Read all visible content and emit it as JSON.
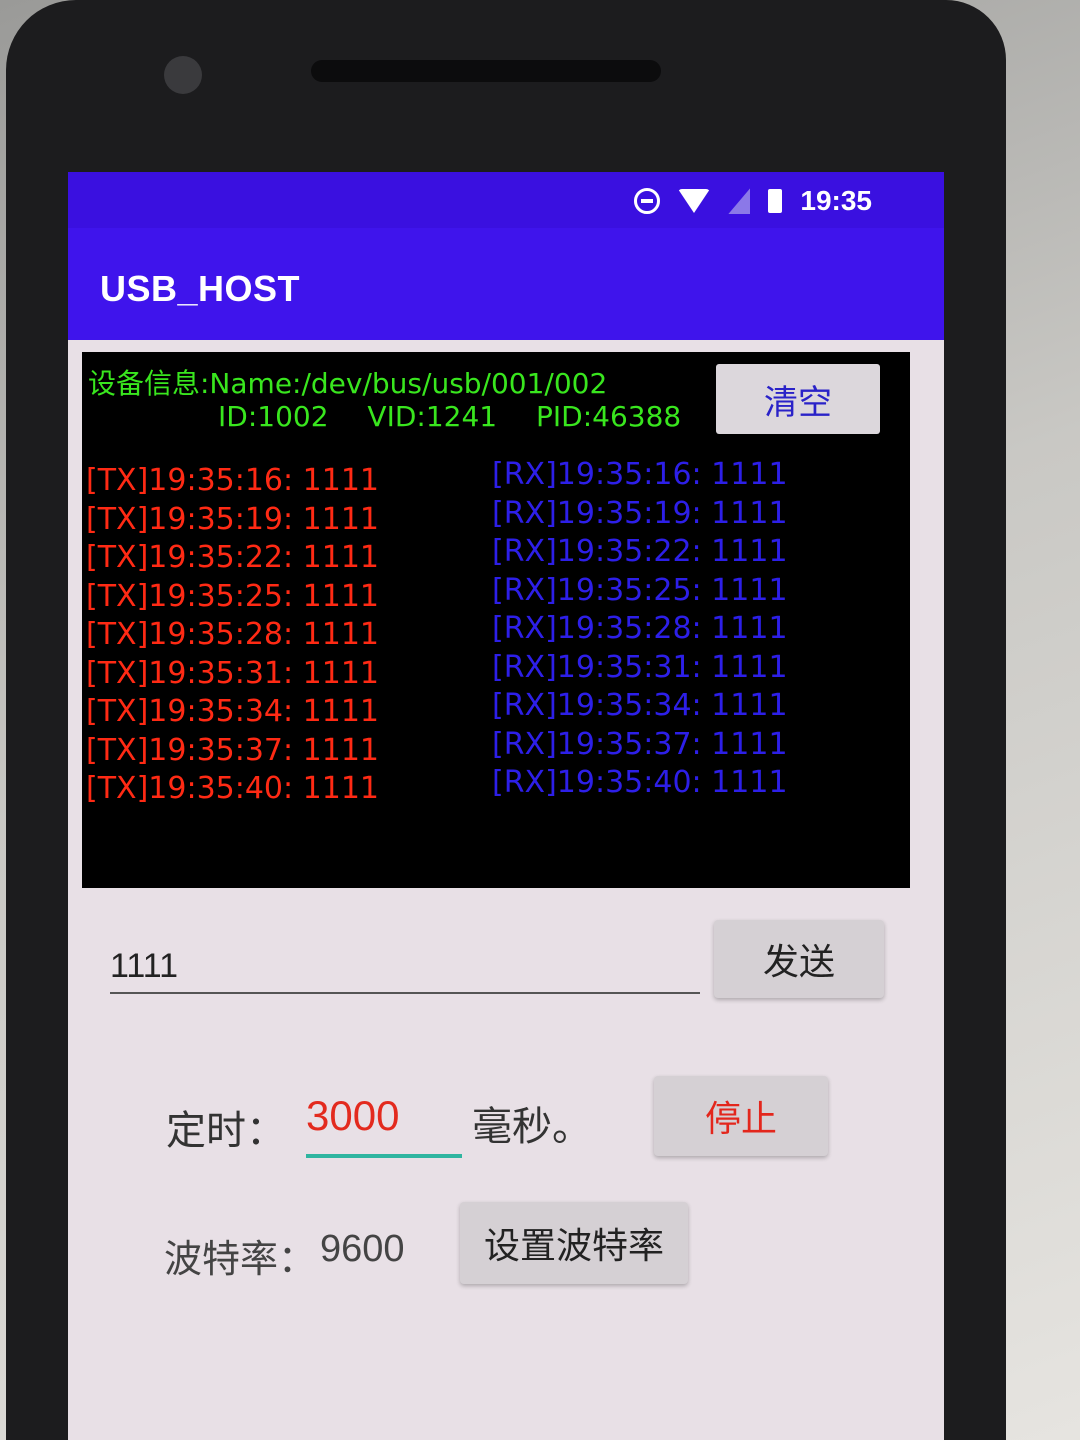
{
  "status_bar": {
    "time": "19:35",
    "icons": [
      "do-not-disturb-icon",
      "wifi-no-internet-icon",
      "no-sim-icon",
      "battery-icon"
    ]
  },
  "app_bar": {
    "title": "USB_HOST"
  },
  "device_info": {
    "line1": "设备信息:Name:/dev/bus/usb/001/002",
    "id": "ID:1002",
    "vid": "VID:1241",
    "pid": "PID:46388"
  },
  "clear_button": "清空",
  "tx_log": [
    "[TX]19:35:16: 1111",
    "[TX]19:35:19: 1111",
    "[TX]19:35:22: 1111",
    "[TX]19:35:25: 1111",
    "[TX]19:35:28: 1111",
    "[TX]19:35:31: 1111",
    "[TX]19:35:34: 1111",
    "[TX]19:35:37: 1111",
    "[TX]19:35:40: 1111"
  ],
  "rx_log": [
    "[RX]19:35:16: 1111",
    "[RX]19:35:19: 1111",
    "[RX]19:35:22: 1111",
    "[RX]19:35:25: 1111",
    "[RX]19:35:28: 1111",
    "[RX]19:35:31: 1111",
    "[RX]19:35:34: 1111",
    "[RX]19:35:37: 1111",
    "[RX]19:35:40: 1111"
  ],
  "send": {
    "value": "1111",
    "button": "发送"
  },
  "timer": {
    "label": "定时：",
    "value": "3000",
    "unit": "毫秒。",
    "stop_button": "停止"
  },
  "baud": {
    "label": "波特率：",
    "value": "9600",
    "button": "设置波特率"
  },
  "colors": {
    "status_bar": "#3a10e0",
    "app_bar": "#3f14ec",
    "device_info_text": "#39e61e",
    "tx_text": "#ff2a14",
    "rx_text": "#2d1fe8",
    "timer_value": "#e32a1e",
    "stop_text": "#e3261c",
    "input_underline": "#2fb5a0"
  }
}
